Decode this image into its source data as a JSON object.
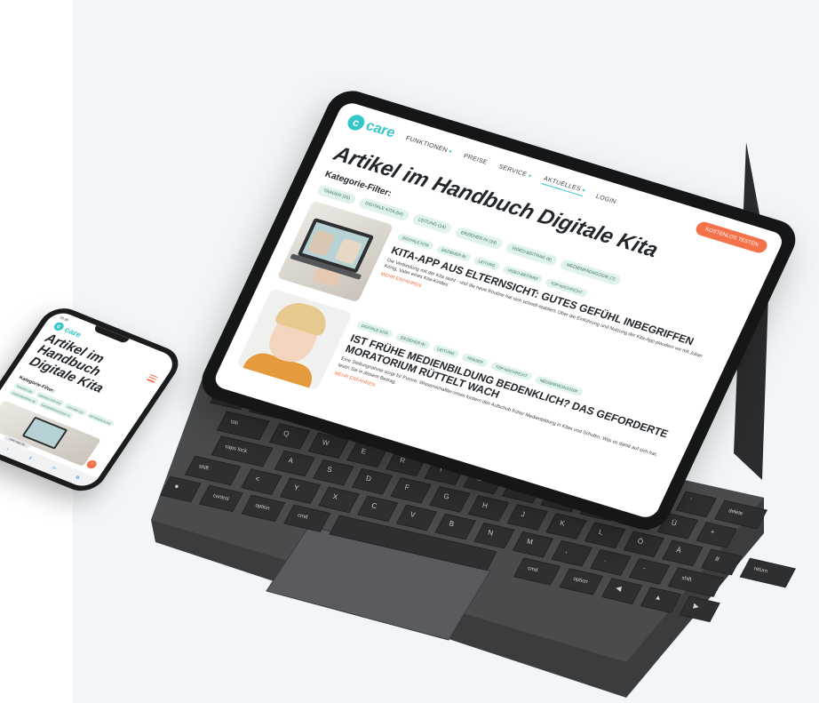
{
  "brand": {
    "logo_letter": "c",
    "logo_text": "care",
    "logo_sub": "by Himmler"
  },
  "tablet": {
    "nav": {
      "items": [
        {
          "label": "FUNKTIONEN",
          "caret": "▾"
        },
        {
          "label": "PREISE",
          "caret": ""
        },
        {
          "label": "SERVICE",
          "caret": "▾"
        },
        {
          "label": "AKTUELLES",
          "caret": "▾"
        }
      ],
      "login": "LOGIN",
      "cta": "KOSTENLOS TESTEN"
    },
    "title": "Artikel im Handbuch Digitale Kita",
    "filter_label": "Kategorie-Filter:",
    "filters": [
      "TRÄGER (25)",
      "DIGITALE KITA (54)",
      "LEITUNG (14)",
      "ERZIEHER:IN (33)",
      "VIDEO-BEITRAG (9)",
      "MEDIENPÄDAGOGIK (7)"
    ],
    "articles": [
      {
        "tags": [
          "DIGITALE KITA",
          "ERZIEHER:IN",
          "LEITUNG",
          "VIDEO-BEITRAG",
          "TOP-NACHRICHT"
        ],
        "headline": "KITA-APP AUS ELTERNSICHT: GUTES GEFÜHL INBEGRIFFEN",
        "desc": "Die Verbindung mit der Kita steht - und die neue Routine hat sich schnell etabliert. Über die Einführung und Nutzung der Kita-App plaudern wir mit Julian König, Vater eines Kita-Kindes.",
        "more": "MEHR ERFAHREN"
      },
      {
        "tags": [
          "DIGITALE KITA",
          "ERZIEHER:IN",
          "LEITUNG",
          "TRÄGER",
          "TOP-NACHRICHT",
          "MEDIENPÄDAGOGIK"
        ],
        "headline": "IST FRÜHE MEDIENBILDUNG BEDENKLICH? DAS GEFORDERTE MORATORIUM RÜTTELT WACH",
        "desc": "Eine Stellungnahme sorgt für Furore: Wissenschaftler:innen fordern den Aufschub früher Medienbildung in Kitas und Schulen. Was es damit auf sich hat, lesen Sie in diesem Beitrag.",
        "more": "MEHR ERFAHREN"
      }
    ]
  },
  "phone": {
    "status_time": "16:26",
    "title": "Artikel im Handbuch Digitale Kita",
    "filter_label": "Kategorie-Filter:",
    "filters": [
      "TRÄGER (25)",
      "DIGITALE KITA (54)",
      "LEITUNG (14)",
      "ERZIEHER:IN (33)",
      "VIDEO-BEITRAG (9)",
      "MEDIENPÄDAGOGIK (7)"
    ],
    "url": "care-app.de",
    "fab": "↑"
  },
  "keyboard": {
    "rows": [
      [
        "esc",
        "1",
        "2",
        "3",
        "4",
        "5",
        "6",
        "7",
        "8",
        "9",
        "0",
        "ß",
        "´",
        "delete"
      ],
      [
        "tab",
        "Q",
        "W",
        "E",
        "R",
        "T",
        "Z",
        "U",
        "I",
        "O",
        "P",
        "Ü",
        "+"
      ],
      [
        "caps lock",
        "A",
        "S",
        "D",
        "F",
        "G",
        "H",
        "J",
        "K",
        "L",
        "Ö",
        "Ä",
        "#",
        "return"
      ],
      [
        "shift",
        "<",
        "Y",
        "X",
        "C",
        "V",
        "B",
        "N",
        "M",
        ",",
        ".",
        "-",
        "shift"
      ],
      [
        "●",
        "control",
        "option",
        "cmd",
        "",
        "cmd",
        "option",
        "◀",
        "▲",
        "▶"
      ]
    ]
  },
  "colors": {
    "accent_teal": "#35c6c6",
    "accent_orange": "#f3724a",
    "chip_bg": "#dff2ec"
  }
}
